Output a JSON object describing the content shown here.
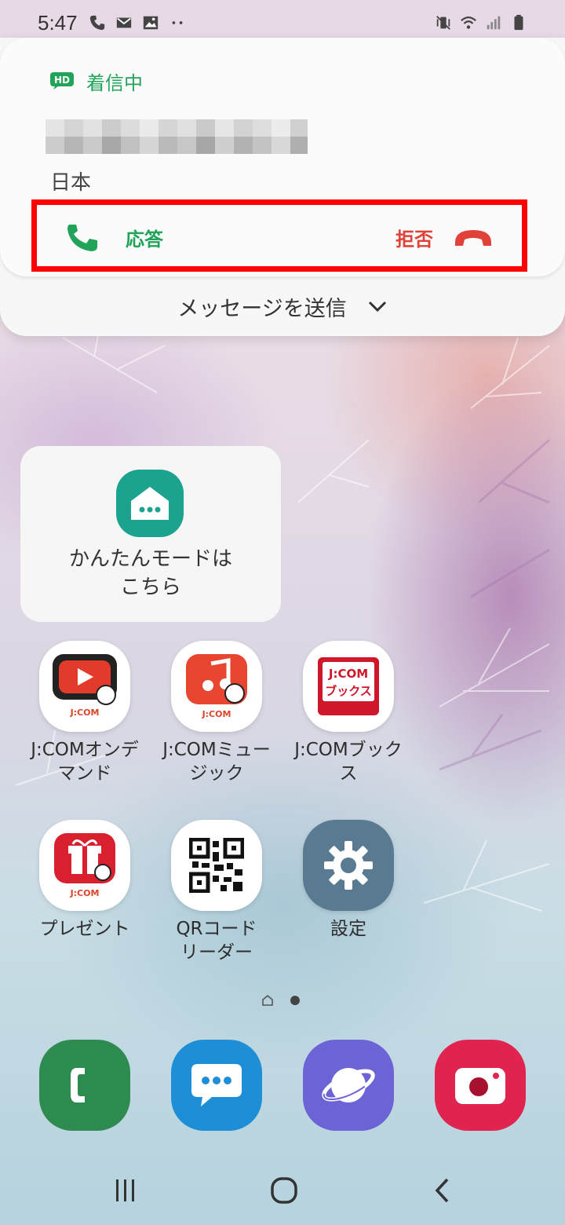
{
  "status_bar": {
    "time": "5:47",
    "left_icons": [
      "phone-icon",
      "mail-icon",
      "gallery-icon",
      "more-notifications-icon"
    ],
    "right_icons": [
      "mute-vibrate-icon",
      "wifi-icon",
      "signal-icon",
      "battery-icon"
    ]
  },
  "incoming_call": {
    "hd_badge": "HD",
    "status": "着信中",
    "location": "日本",
    "answer_label": "応答",
    "decline_label": "拒否",
    "send_message_label": "メッセージを送信",
    "highlight_color": "#ff0000",
    "answer_color": "#22a35a",
    "decline_color": "#e0423a"
  },
  "easy_mode": {
    "label": "かんたんモードは\nこちら",
    "icon": "home-chat-icon",
    "color": "#1ba38f"
  },
  "apps": [
    {
      "label": "J:COMオンデ\nマンド",
      "icon": "jcom-on-demand-icon",
      "logo_text": "J:COM"
    },
    {
      "label": "J:COMミュー\nジック",
      "icon": "jcom-music-icon",
      "logo_text": "J:COM"
    },
    {
      "label": "J:COMブック\nス",
      "icon": "jcom-books-icon",
      "logo_text": "J:COM\nブックス"
    },
    {
      "label": "プレゼント",
      "icon": "present-icon",
      "logo_text": "J:COM"
    },
    {
      "label": "QRコード\nリーダー",
      "icon": "qr-code-icon"
    },
    {
      "label": "設定",
      "icon": "settings-gear-icon"
    }
  ],
  "page_indicator": {
    "pages": 2,
    "current": 2,
    "first_is_home": true
  },
  "dock": [
    {
      "icon": "phone-app-icon",
      "color": "#2e8b4f"
    },
    {
      "icon": "messages-app-icon",
      "color": "#1e8fd6"
    },
    {
      "icon": "internet-browser-icon",
      "color": "#6b63d6"
    },
    {
      "icon": "camera-app-icon",
      "color": "#e0244f"
    }
  ],
  "nav_bar": [
    "recents-icon",
    "home-icon",
    "back-icon"
  ]
}
